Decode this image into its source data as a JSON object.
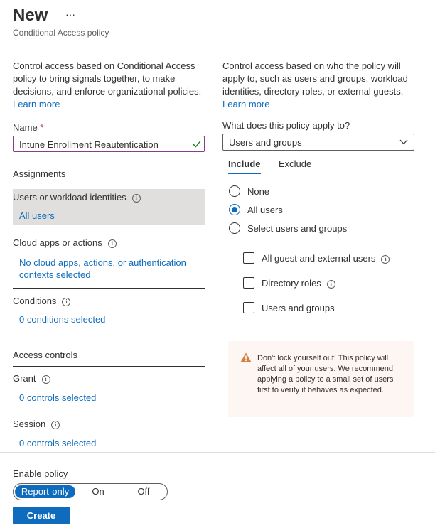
{
  "header": {
    "title": "New",
    "more_glyph": "···",
    "subtitle": "Conditional Access policy"
  },
  "left": {
    "description": "Control access based on Conditional Access policy to bring signals together, to make decisions, and enforce organizational policies.",
    "learn_more": "Learn more",
    "name_label": "Name",
    "required_mark": "*",
    "name_value": "Intune Enrollment Reautentication",
    "assignments_heading": "Assignments",
    "users_label": "Users or workload identities",
    "users_value": "All users",
    "cloud_label": "Cloud apps or actions",
    "cloud_value": "No cloud apps, actions, or authentication contexts selected",
    "conditions_label": "Conditions",
    "conditions_value": "0 conditions selected",
    "access_heading": "Access controls",
    "grant_label": "Grant",
    "grant_value": "0 controls selected",
    "session_label": "Session",
    "session_value": "0 controls selected"
  },
  "right": {
    "description": "Control access based on who the policy will apply to, such as users and groups, workload identities, directory roles, or external guests.",
    "learn_more": "Learn more",
    "apply_label": "What does this policy apply to?",
    "apply_value": "Users and groups",
    "tabs": [
      {
        "label": "Include",
        "selected": true
      },
      {
        "label": "Exclude",
        "selected": false
      }
    ],
    "radios": [
      {
        "label": "None",
        "checked": false
      },
      {
        "label": "All users",
        "checked": true
      },
      {
        "label": "Select users and groups",
        "checked": false
      }
    ],
    "checkboxes": [
      {
        "label": "All guest and external users",
        "checked": false
      },
      {
        "label": "Directory roles",
        "checked": false
      },
      {
        "label": "Users and groups",
        "checked": false
      }
    ],
    "warning": "Don't lock yourself out! This policy will affect all of your users. We recommend applying a policy to a small set of users first to verify it behaves as expected."
  },
  "footer": {
    "enable_label": "Enable policy",
    "toggle_options": [
      "Report-only",
      "On",
      "Off"
    ],
    "toggle_selected": "Report-only",
    "create_label": "Create"
  },
  "colors": {
    "accent": "#0f6cbd",
    "selected_bg": "#e1dfdd",
    "warning_bg": "#fdf6f3",
    "warning_icon": "#d67f3c",
    "name_border": "#8a3a8f"
  },
  "icons": {
    "more": "ellipsis-icon",
    "check": "checkmark-icon",
    "dropdown": "chevron-down-icon",
    "info": "info-icon",
    "warning": "warning-icon"
  }
}
